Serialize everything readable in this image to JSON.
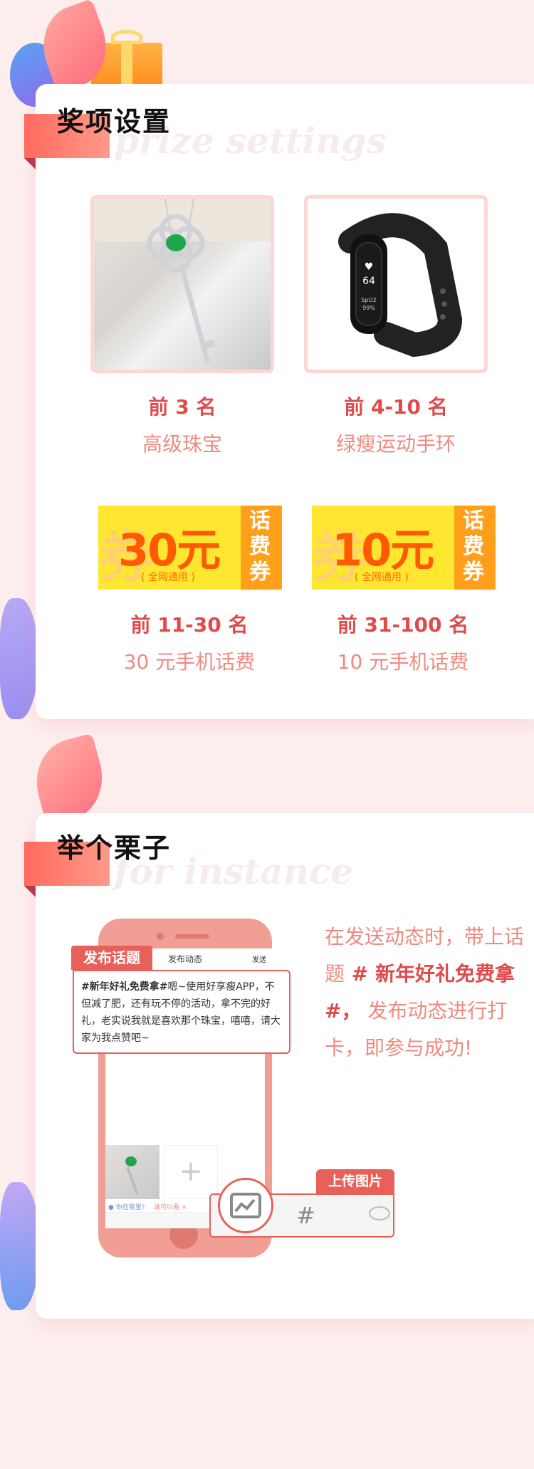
{
  "section1": {
    "title": "奖项设置",
    "subtitle": "prize settings",
    "prizes": [
      {
        "rank": "前 3 名",
        "name": "高级珠宝"
      },
      {
        "rank": "前 4-10 名",
        "name": "绿瘦运动手环"
      },
      {
        "rank": "前 11-30 名",
        "name": "30 元手机话费"
      },
      {
        "rank": "前 31-100 名",
        "name": "10 元手机话费"
      }
    ],
    "coupons": [
      {
        "amount": "30元",
        "note": "( 全网通用 )",
        "side": "话费券",
        "bg": "券"
      },
      {
        "amount": "10元",
        "note": "( 全网通用 )",
        "side": "话费券",
        "bg": "券"
      }
    ]
  },
  "section2": {
    "title": "举个栗子",
    "subtitle": "for instance",
    "phone": {
      "tag": "发布话题",
      "topbar_title": "发布动态",
      "topbar_send": "发送",
      "post_topic": "#新年好礼免费拿#",
      "post_text": "嗯~使用好享瘦APP，不但减了肥，还有玩不停的活动，拿不完的好礼，老实说我就是喜欢那个珠宝，嘻嘻，请大家为我点赞吧~",
      "location": "你在哪里?",
      "tag_chip": "谁可以看 ×",
      "upload_tag": "上传图片",
      "hash_symbol": "#"
    },
    "desc": {
      "part1": "在发送动态时，带上话题",
      "highlight": " # 新年好礼免费拿 #，",
      "part2": "  发布动态进行打卡，即参与成功!"
    }
  },
  "colors": {
    "accent": "#e04a4a",
    "pink": "#f08a80",
    "phone": "#f19e95",
    "background": "#fdeeee"
  }
}
